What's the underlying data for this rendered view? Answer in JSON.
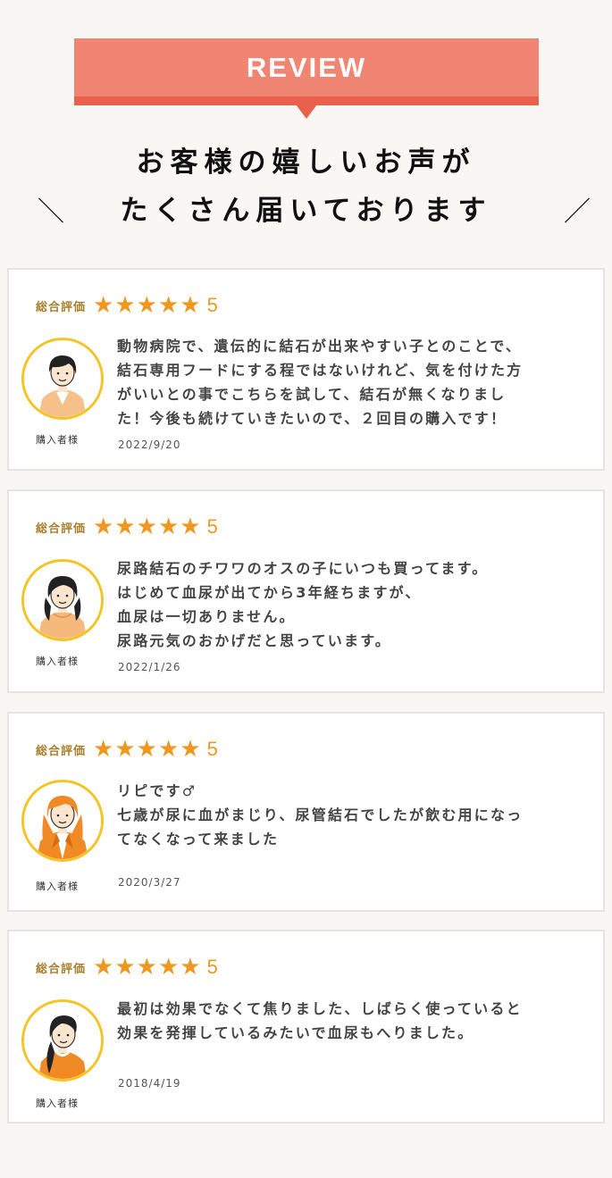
{
  "banner": {
    "label": "REVIEW"
  },
  "headline": {
    "line1": "お客様の嬉しいお声が",
    "line2": "たくさん届いております",
    "slash_left": "＼",
    "slash_right": "／"
  },
  "colors": {
    "banner": "#f08573",
    "banner_dark": "#e9604c",
    "star": "#ee9822",
    "avatar_ring": "#f6c325"
  },
  "reviews": [
    {
      "rating_label": "総合評価",
      "stars": 5,
      "score": "5",
      "buyer": "購入者様",
      "text": "動物病院で、遺伝的に結石が出来やすい子とのことで、\n結石専用フードにする程ではないけれど、気を付けた方\nがいいとの事でこちらを試して、結石が無くなりまし\nた！今後も続けていきたいので、２回目の購入です！",
      "date": "2022/9/20",
      "avatar": "short-hair-woman-icon"
    },
    {
      "rating_label": "総合評価",
      "stars": 5,
      "score": "5",
      "buyer": "購入者様",
      "text": "尿路結石のチワワのオスの子にいつも買ってます。\nはじめて血尿が出てから3年経ちますが、\n血尿は一切ありません。\n尿路元気のおかげだと思っています。",
      "date": "2022/1/26",
      "avatar": "curly-hair-woman-icon"
    },
    {
      "rating_label": "総合評価",
      "stars": 5,
      "score": "5",
      "buyer": "購入者様",
      "text": "リピです♂\n七歳が尿に血がまじり、尿管結石でしたが飲む用になっ\nてなくなって来ました",
      "date": "2020/3/27",
      "avatar": "long-orange-hair-woman-icon"
    },
    {
      "rating_label": "総合評価",
      "stars": 5,
      "score": "5",
      "buyer": "購入者様",
      "text": "最初は効果でなくて焦りました、しばらく使っていると\n効果を発揮しているみたいで血尿もへりました。",
      "date": "2018/4/19",
      "avatar": "ponytail-woman-icon"
    }
  ]
}
